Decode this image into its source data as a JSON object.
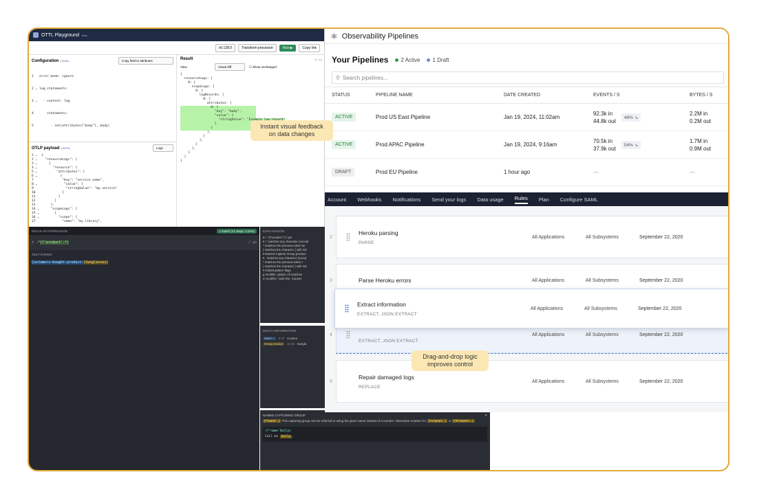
{
  "ottl": {
    "app_title": "OTTL Playground",
    "app_version": "beta",
    "version_select": "v0.128.0",
    "processor_select": "Transform processor",
    "run_label": "Run ▶",
    "copy_label": "Copy link",
    "config_title": "Configuration",
    "config_tag": "(YAML)",
    "config_example": "Copy field to attributes",
    "config_lines": [
      "1   error_mode: ignore",
      "2 ⌄ log_statements:",
      "3 ⌄   - context: log",
      "4       statements:",
      "5         - set(attributes[\"body\"], body)"
    ],
    "result_title": "Result",
    "result_time": "81 ms",
    "result_view_label": "View",
    "result_view": "Visual diff",
    "show_unchanged": "Show unchanged",
    "result_lines": [
      "{",
      "  resourceLogs: [",
      "    0: {",
      "      scopeLogs: [",
      "        0: {",
      "          logRecords: [",
      "            0: {",
      "              attributes: [",
      "                0: {",
      "                  \"key\": \"body\",",
      "                  \"value\": {",
      "                    \"stringValue\": \"Example log record\"",
      "                  }",
      "                }",
      "              ],",
      "            }",
      "          ],",
      "        }",
      "      ],",
      "    }",
      "  ]",
      "}"
    ],
    "payload_title": "OTLP payload",
    "payload_tag": "(JSON)",
    "payload_select": "Logs",
    "payload_lines": [
      "1 ⌄  {",
      "2 ⌄    \"resourceLogs\": [",
      "3 ⌄      {",
      "4 ⌄        \"resource\": {",
      "5 ⌄          \"attributes\": [",
      "6 ⌄            {",
      "7               \"key\": \"service.name\",",
      "8 ⌄              \"value\": {",
      "9                 \"stringValue\": \"my.service\"",
      "10              }",
      "11            }",
      "12          ]",
      "13        },",
      "14 ⌄      \"scopeLogs\": [",
      "15 ⌄        {",
      "16 ⌄          \"scope\": {",
      "17              \"name\": \"my.library\","
    ]
  },
  "regex": {
    "header_label": "REGULAR EXPRESSION",
    "match_badge": "1 match (21 steps, 0.2ms)",
    "pattern_prefix": "/ .*",
    "pattern_group": "(?'product'.*)",
    "pattern_suffix": "/",
    "flags": "/ gm",
    "test_label": "TEST STRING",
    "test_prefix": "Customers-bought-product-",
    "test_group": "(Sunglasses)",
    "explanation_title": "EXPLANATION",
    "explanation_lines": [
      "▾ / .*(?'product'.*) / gm",
      "  ▾ .* matches any character (except",
      "     * matches the previous token be",
      "  { matches the character { with ind",
      "  ▾ Named Capture Group product",
      "     ▾ . matches any character (excep",
      "        * matches the previous token t",
      "  } matches the character } with ind",
      "▾ Global pattern flags",
      "     g modifier: global. All matches",
      "     m modifier: multi line. Causes"
    ],
    "match_title": "MATCH INFORMATION",
    "match_rows": [
      {
        "label": "Match 1",
        "range": "0-37",
        "value": "Custom"
      },
      {
        "label": "Group product",
        "range": "26-36",
        "value": "Sungla"
      }
    ],
    "named_title": "NAMED CAPTURING GROUP",
    "named_token": "(?'name'...)",
    "named_text": "This capturing group can be referred to using the given name instead of a number. Alternative notation for",
    "named_alt1": "(?<name>...)",
    "named_or": "or",
    "named_alt2": "(?P<name>...)",
    "named_example_pattern": "(?'name'Sally)",
    "named_example_text_prefix": "Call me ",
    "named_example_text_match": "Sally",
    "named_example_text_suffix": "."
  },
  "pipelines": {
    "app_icon": "pipeline-icon",
    "app_title": "Observability Pipelines",
    "heading": "Your Pipelines",
    "active_count": "2 Active",
    "draft_count": "1 Draft",
    "active_color": "#2e9e4f",
    "draft_color": "#7a86c7",
    "search_placeholder": "Search pipelines...",
    "columns": [
      "STATUS",
      "PIPELINE NAME",
      "DATE CREATED",
      "EVENTS / S",
      "BYTES / S"
    ],
    "rows": [
      {
        "status": "ACTIVE",
        "name": "Prod US East Pipeline",
        "date": "Jan 19, 2024, 11:02am",
        "events_in": "92.3k in",
        "events_out": "44.8k out",
        "pct": "48%",
        "bytes_in": "2.2M in",
        "bytes_out": "0.2M out"
      },
      {
        "status": "ACTIVE",
        "name": "Prod APAC Pipeline",
        "date": "Jan 19, 2024, 9:16am",
        "events_in": "70.5k in",
        "events_out": "37.9k out",
        "pct": "54%",
        "bytes_in": "1.7M in",
        "bytes_out": "0.9M out"
      },
      {
        "status": "DRAFT",
        "name": "Prod EU Pipeline",
        "date": "1 hour ago",
        "events_dash": "—",
        "bytes_dash": "—"
      }
    ]
  },
  "rules": {
    "nav": [
      "Account",
      "Webhooks",
      "Notifications",
      "Send your logs",
      "Data usage",
      "Rules",
      "Plan",
      "Configure SAML"
    ],
    "active_nav": "Rules",
    "items": [
      {
        "num": "2",
        "name": "Heroku parsing",
        "type": "PARSE",
        "apps": "All Applications",
        "subs": "All Subsystems",
        "date": "September 22, 2020"
      },
      {
        "num": "3",
        "name": "Parse Heroku errors",
        "apps": "All Applications",
        "subs": "All Subsystems",
        "date": "September 22, 2020"
      },
      {
        "name": "Extract information",
        "type": "EXTRACT, JSON EXTRACT",
        "apps": "All Applications",
        "subs": "All Subsystems",
        "date": "September 22, 2020"
      },
      {
        "num": "4",
        "type": "EXTRACT, JSON EXTRACT",
        "apps": "All Applications",
        "subs": "All Subsystems",
        "date": "September 22, 2020"
      },
      {
        "num": "5",
        "name": "Repair damaged logs",
        "type": "REPLACE",
        "apps": "All Applications",
        "subs": "All Subsystems",
        "date": "September 22, 2020"
      }
    ]
  },
  "callouts": {
    "feedback": "Instant visual feedback on data changes",
    "dragdrop": "Drag-and-drop logic improves control"
  }
}
